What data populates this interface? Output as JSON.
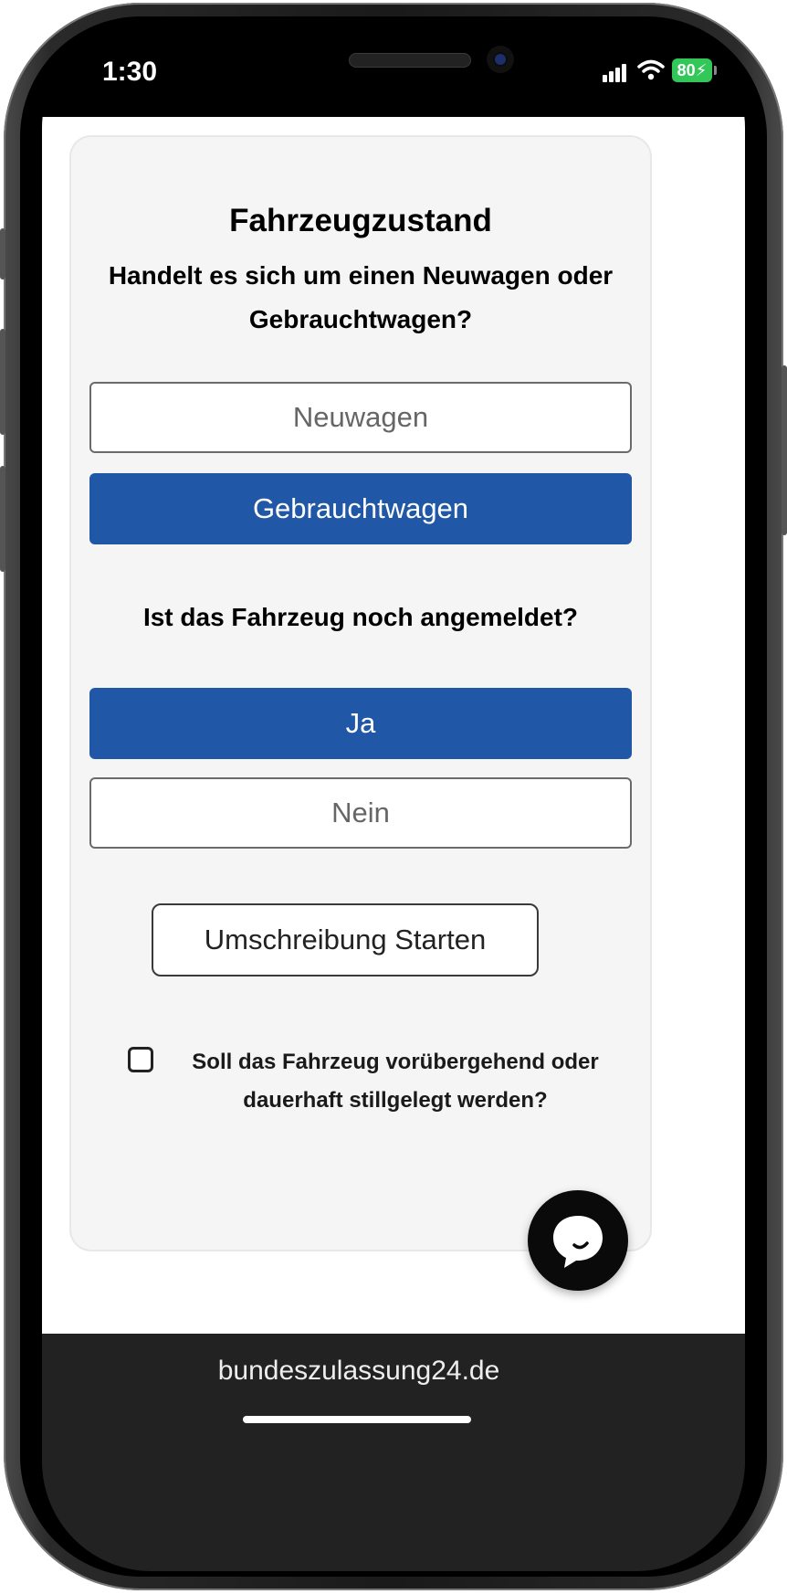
{
  "status_bar": {
    "time": "1:30",
    "battery": "80"
  },
  "card": {
    "title": "Fahrzeugzustand",
    "question_condition": "Handelt es sich um einen Neuwagen oder Gebrauchtwagen?",
    "options_condition": [
      {
        "label": "Neuwagen",
        "selected": false
      },
      {
        "label": "Gebrauchtwagen",
        "selected": true
      }
    ],
    "question_registered": "Ist das Fahrzeug noch angemeldet?",
    "options_registered": [
      {
        "label": "Ja",
        "selected": true
      },
      {
        "label": "Nein",
        "selected": false
      }
    ],
    "start_button": "Umschreibung Starten",
    "checkbox_label": "Soll das Fahrzeug vorübergehend oder dauerhaft stillgelegt werden?",
    "checkbox_checked": false
  },
  "browser": {
    "url": "bundeszulassung24.de"
  },
  "icons": {
    "chat": "chat-bubble-icon",
    "signal": "cellular-signal-icon",
    "wifi": "wifi-icon",
    "battery": "battery-charging-icon"
  },
  "colors": {
    "accent": "#2057a6",
    "card_bg": "#f5f5f5",
    "url_bar": "#222222"
  }
}
